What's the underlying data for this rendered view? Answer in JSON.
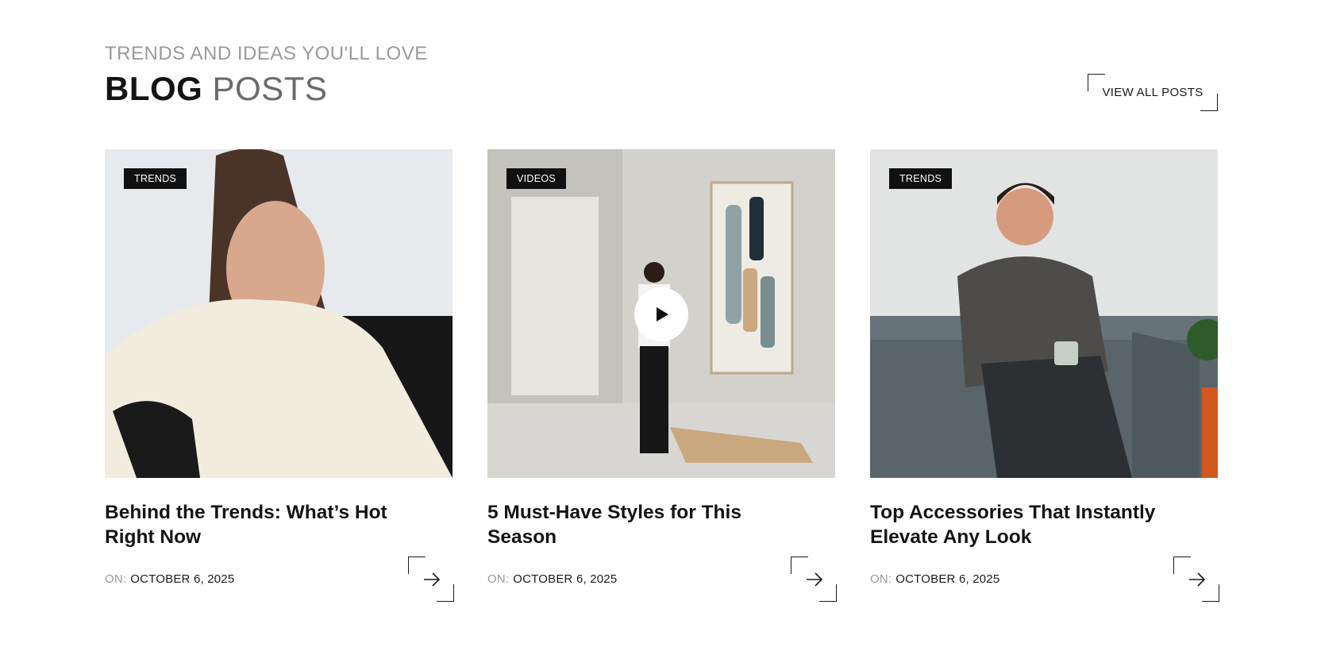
{
  "header": {
    "subtitle": "TRENDS AND IDEAS YOU'LL LOVE",
    "title_bold": "BLOG",
    "title_light": "POSTS",
    "view_all_label": "VIEW ALL POSTS"
  },
  "posts": [
    {
      "badge": "TRENDS",
      "title": "Behind the Trends: What’s Hot Right Now",
      "date_prefix": "ON:",
      "date": "OCTOBER 6, 2025",
      "has_video": false
    },
    {
      "badge": "VIDEOS",
      "title": "5 Must-Have Styles for This Season",
      "date_prefix": "ON:",
      "date": "OCTOBER 6, 2025",
      "has_video": true
    },
    {
      "badge": "TRENDS",
      "title": "Top Accessories That Instantly Elevate Any Look",
      "date_prefix": "ON:",
      "date": "OCTOBER 6, 2025",
      "has_video": false
    }
  ],
  "icons": {
    "play": "play-icon",
    "arrow": "arrow-right-icon"
  },
  "colors": {
    "text": "#141414",
    "muted": "#9a9a9a",
    "badge_bg": "#111111"
  }
}
